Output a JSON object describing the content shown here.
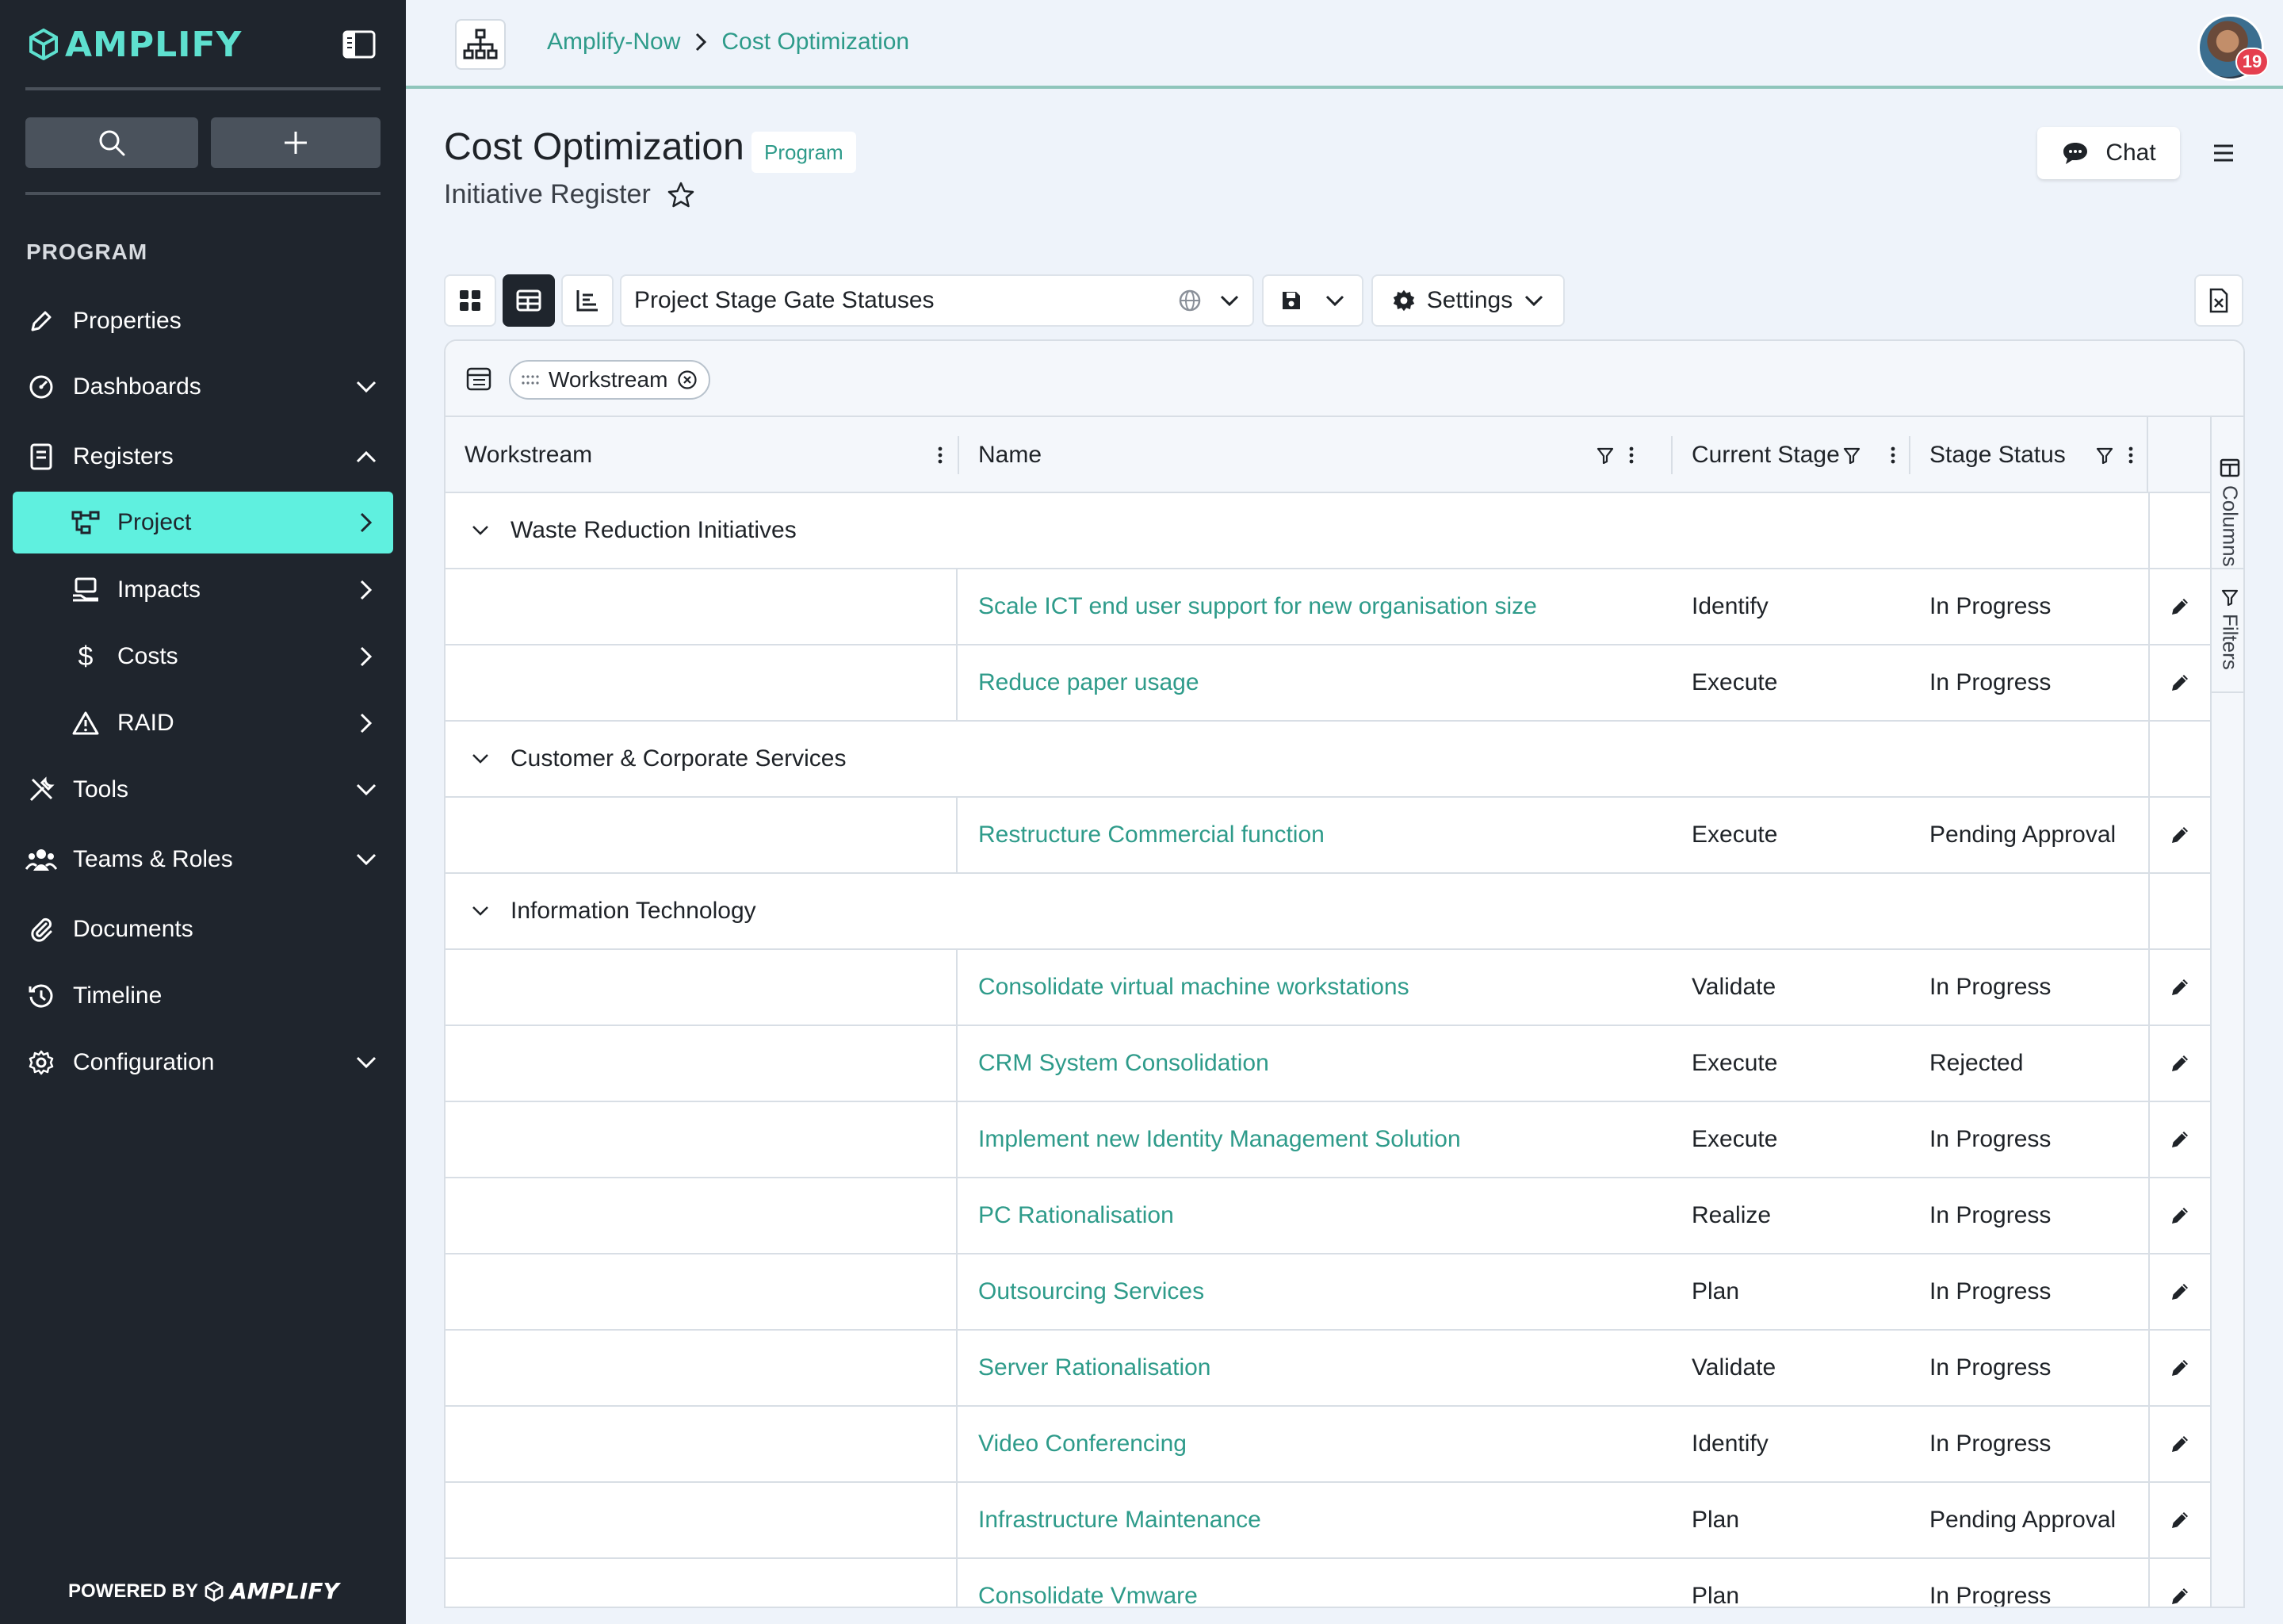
{
  "brand": {
    "name": "AMPLIFY",
    "powered_by": "POWERED BY",
    "accent": "#5ff0df"
  },
  "sidebar": {
    "section_title": "PROGRAM",
    "items": [
      {
        "label": "Properties",
        "icon": "pencil-icon"
      },
      {
        "label": "Dashboards",
        "icon": "gauge-icon"
      },
      {
        "label": "Registers",
        "icon": "register-icon"
      },
      {
        "label": "Project",
        "icon": "project-icon"
      },
      {
        "label": "Impacts",
        "icon": "impacts-icon"
      },
      {
        "label": "Costs",
        "icon": "dollar-icon"
      },
      {
        "label": "RAID",
        "icon": "warning-icon"
      },
      {
        "label": "Tools",
        "icon": "tools-icon"
      },
      {
        "label": "Teams & Roles",
        "icon": "team-icon"
      },
      {
        "label": "Documents",
        "icon": "paperclip-icon"
      },
      {
        "label": "Timeline",
        "icon": "history-icon"
      },
      {
        "label": "Configuration",
        "icon": "gear-icon"
      }
    ]
  },
  "topbar": {
    "breadcrumbs": [
      "Amplify-Now",
      "Cost Optimization"
    ],
    "notifications": "19"
  },
  "header": {
    "title": "Cost Optimization",
    "badge": "Program",
    "subtitle": "Initiative Register",
    "chat_label": "Chat"
  },
  "toolbar": {
    "view_name": "Project Stage Gate Statuses",
    "settings_label": "Settings"
  },
  "grid": {
    "group_chip": "Workstream",
    "columns": [
      "Workstream",
      "Name",
      "Current Stage",
      "Stage Status"
    ],
    "side_tabs": [
      "Columns",
      "Filters"
    ],
    "groups": [
      {
        "name": "Waste Reduction Initiatives",
        "rows": [
          {
            "name": "Scale ICT end user support for new organisation size",
            "stage": "Identify",
            "status": "In Progress"
          },
          {
            "name": "Reduce paper usage",
            "stage": "Execute",
            "status": "In Progress"
          }
        ]
      },
      {
        "name": "Customer & Corporate Services",
        "rows": [
          {
            "name": "Restructure Commercial function",
            "stage": "Execute",
            "status": "Pending Approval"
          }
        ]
      },
      {
        "name": "Information Technology",
        "rows": [
          {
            "name": "Consolidate virtual machine workstations",
            "stage": "Validate",
            "status": "In Progress"
          },
          {
            "name": "CRM System Consolidation",
            "stage": "Execute",
            "status": "Rejected"
          },
          {
            "name": "Implement new Identity Management Solution",
            "stage": "Execute",
            "status": "In Progress"
          },
          {
            "name": "PC Rationalisation",
            "stage": "Realize",
            "status": "In Progress"
          },
          {
            "name": "Outsourcing Services",
            "stage": "Plan",
            "status": "In Progress"
          },
          {
            "name": "Server Rationalisation",
            "stage": "Validate",
            "status": "In Progress"
          },
          {
            "name": "Video Conferencing",
            "stage": "Identify",
            "status": "In Progress"
          },
          {
            "name": "Infrastructure Maintenance",
            "stage": "Plan",
            "status": "Pending Approval"
          },
          {
            "name": "Consolidate Vmware",
            "stage": "Plan",
            "status": "In Progress"
          }
        ]
      }
    ]
  }
}
